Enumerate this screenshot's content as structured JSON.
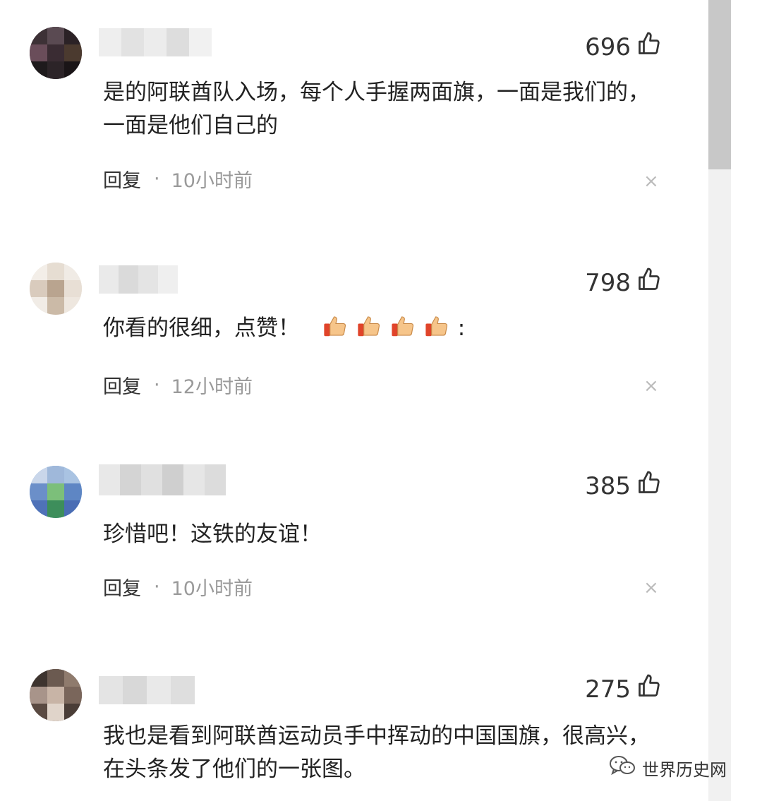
{
  "comments": [
    {
      "likes": "696",
      "text": "是的阿联酋队入场，每个人手握两面旗，一面是我们的，一面是他们自己的",
      "reply_label": "回复",
      "time": "10小时前"
    },
    {
      "likes": "798",
      "text": "你看的很细，点赞！",
      "text_suffix": ":",
      "reply_label": "回复",
      "time": "12小时前"
    },
    {
      "likes": "385",
      "text": "珍惜吧！这铁的友谊！",
      "reply_label": "回复",
      "time": "10小时前"
    },
    {
      "likes": "275",
      "text": "我也是看到阿联酋运动员手中挥动的中国国旗，很高兴，在头条发了他们的一张图。"
    }
  ],
  "close_glyph": "×",
  "watermark": {
    "label": "世界历史网"
  },
  "colors": {
    "like_icon": "#333333",
    "time_text": "#9a9a9a",
    "close": "#bbbbbb"
  },
  "icons": {
    "like": "thumb-up-icon",
    "close": "close-icon",
    "emoji": "thumbs-up-emoji-icon"
  }
}
